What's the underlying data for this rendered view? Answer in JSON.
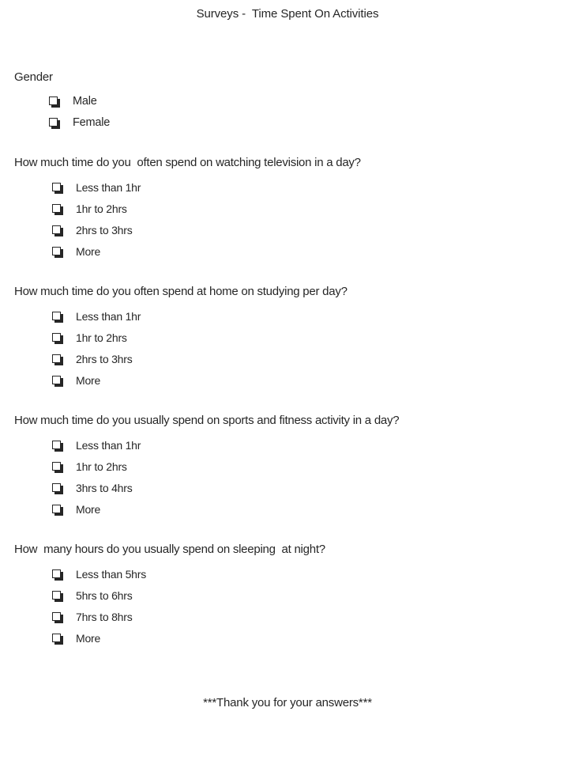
{
  "document": {
    "title": "Surveys -  Time Spent On Activities",
    "footer": "***Thank you for your answers***",
    "text_color": "#262626",
    "background_color": "#ffffff",
    "checkbox_glyph": "empty-square-shadowed"
  },
  "sections": [
    {
      "prompt": "Gender",
      "options": [
        {
          "label": "Male"
        },
        {
          "label": "Female"
        }
      ]
    },
    {
      "prompt": "How much time do you  often spend on watching television in a day?",
      "options": [
        {
          "label": "Less than 1hr"
        },
        {
          "label": "1hr to 2hrs"
        },
        {
          "label": "2hrs to 3hrs"
        },
        {
          "label": "More"
        }
      ]
    },
    {
      "prompt": "How much time do you often spend at home on studying per day?",
      "options": [
        {
          "label": "Less than 1hr"
        },
        {
          "label": "1hr to 2hrs"
        },
        {
          "label": "2hrs to 3hrs"
        },
        {
          "label": "More"
        }
      ]
    },
    {
      "prompt": "How much time do you usually spend on sports and fitness activity in a day?",
      "options": [
        {
          "label": "Less than 1hr"
        },
        {
          "label": "1hr to 2hrs"
        },
        {
          "label": "3hrs to 4hrs"
        },
        {
          "label": "More"
        }
      ]
    },
    {
      "prompt": "How  many hours do you usually spend on sleeping  at night?",
      "options": [
        {
          "label": "Less than 5hrs"
        },
        {
          "label": "5hrs to 6hrs"
        },
        {
          "label": "7hrs to 8hrs"
        },
        {
          "label": "More"
        }
      ]
    }
  ]
}
